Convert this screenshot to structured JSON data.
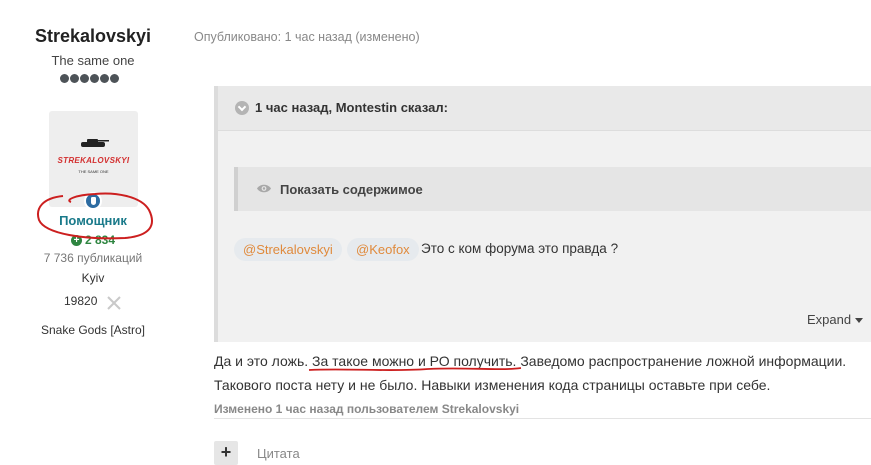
{
  "author": {
    "name": "Strekalovskyi",
    "title": "The same one",
    "group": "Помощник",
    "reputation": "2 834",
    "posts": "7 736 публикаций",
    "city": "Kyiv",
    "stat_value": "19820",
    "clan": "Snake Gods [Astro]",
    "avatar_logo_text": "STREKALOVSKYI",
    "avatar_logo_sub": "THE SAME ONE",
    "rank_pips": 6
  },
  "post": {
    "meta": "Опубликовано: 1 час назад (изменено)",
    "quote": {
      "header": "1 час назад, Montestin сказал:",
      "spoiler_label": "Показать содержимое",
      "mentions": [
        "@Strekalovskyi",
        "@Keofox"
      ],
      "text": "Это с ком форума это правда ?",
      "expand_label": "Expand"
    },
    "body_line1_a": "Да и это ложь. ",
    "body_line1_b": "За такое можно и РО получить.",
    "body_line1_c": " Заведомо распространение ложной информации.",
    "body_line2": "Такового поста нету и не было. Навыки изменения кода страницы оставьте при себе.",
    "edited": "Изменено 1 час назад пользователем Strekalovskyi",
    "quote_button": "Цитата"
  },
  "colors": {
    "group": "#1a7a8a",
    "reputation": "#2e8540",
    "mention": "#e08a3c",
    "annotation": "#cc1f1f"
  },
  "icons": [
    "chevron-down-icon",
    "eye-icon",
    "plus-icon",
    "reputation-plus-icon",
    "swords-icon",
    "tank-logo-icon",
    "group-badge-icon"
  ]
}
